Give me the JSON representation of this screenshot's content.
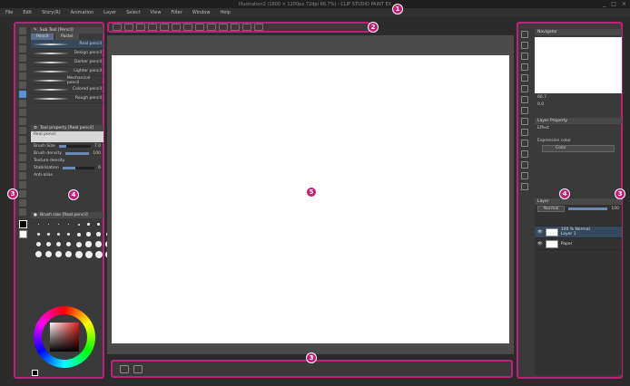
{
  "app": {
    "title": "Illustration2 (1600 × 1200px 72dpi 66.7%) - CLIP STUDIO PAINT EX",
    "window_controls": [
      "_",
      "□",
      "×"
    ]
  },
  "menu": [
    "File",
    "Edit",
    "Story(R)",
    "Animation",
    "Layer",
    "Select",
    "View",
    "Filter",
    "Window",
    "Help"
  ],
  "badges": {
    "b1": "1",
    "b2": "2",
    "b3_left": "3",
    "b3_right": "3",
    "b3_bottom": "3",
    "b4_left": "4",
    "b4_right": "4",
    "b5": "5"
  },
  "sub_tool": {
    "header": "Sub Tool [Pencil]",
    "tabs": [
      "Pencil",
      "Pastel"
    ],
    "brushes": [
      "Real pencil",
      "Design pencil",
      "Darker pencil",
      "Lighter pencil",
      "Mechanical pencil",
      "Colored pencil",
      "Rough pencil"
    ]
  },
  "tool_property": {
    "header": "Tool property [Real pencil]",
    "preset": "Real pencil",
    "rows": [
      {
        "label": "Brush Size",
        "value": "7.0"
      },
      {
        "label": "Brush density",
        "value": "100"
      },
      {
        "label": "Texture density",
        "value": ""
      },
      {
        "label": "Stabilization",
        "value": "6"
      },
      {
        "label": "Anti-alias",
        "value": ""
      }
    ],
    "size_fill": 0.25,
    "density_fill": 1.0,
    "stab_fill": 0.4
  },
  "brush_size": {
    "header": "Brush size [Real pencil]",
    "sizes": [
      "0.7",
      "1",
      "1.5",
      "2",
      "2.5",
      "3",
      "4",
      "5",
      "6",
      "7",
      "8",
      "10",
      "12",
      "15",
      "17",
      "20",
      "25",
      "30",
      "40",
      "50",
      "60",
      "70",
      "80",
      "100",
      "120",
      "150",
      "170",
      "200",
      "250",
      "300",
      "400",
      "500"
    ]
  },
  "navigator": {
    "header": "Navigator",
    "zoom": "66.7",
    "angle": "0.0"
  },
  "layer_property": {
    "header": "Layer Property",
    "effect_label": "Effect",
    "expression_label": "Expression color",
    "expression_value": "Color"
  },
  "layer": {
    "header": "Layer",
    "blend_mode": "Normal",
    "opacity": "100",
    "layers": [
      {
        "name": "100 % Normal",
        "sub": "Layer 1",
        "selected": true
      },
      {
        "name": "Paper",
        "sub": "",
        "selected": false
      }
    ]
  },
  "colors": {
    "accent": "#c0207a",
    "selection": "#34495e"
  }
}
